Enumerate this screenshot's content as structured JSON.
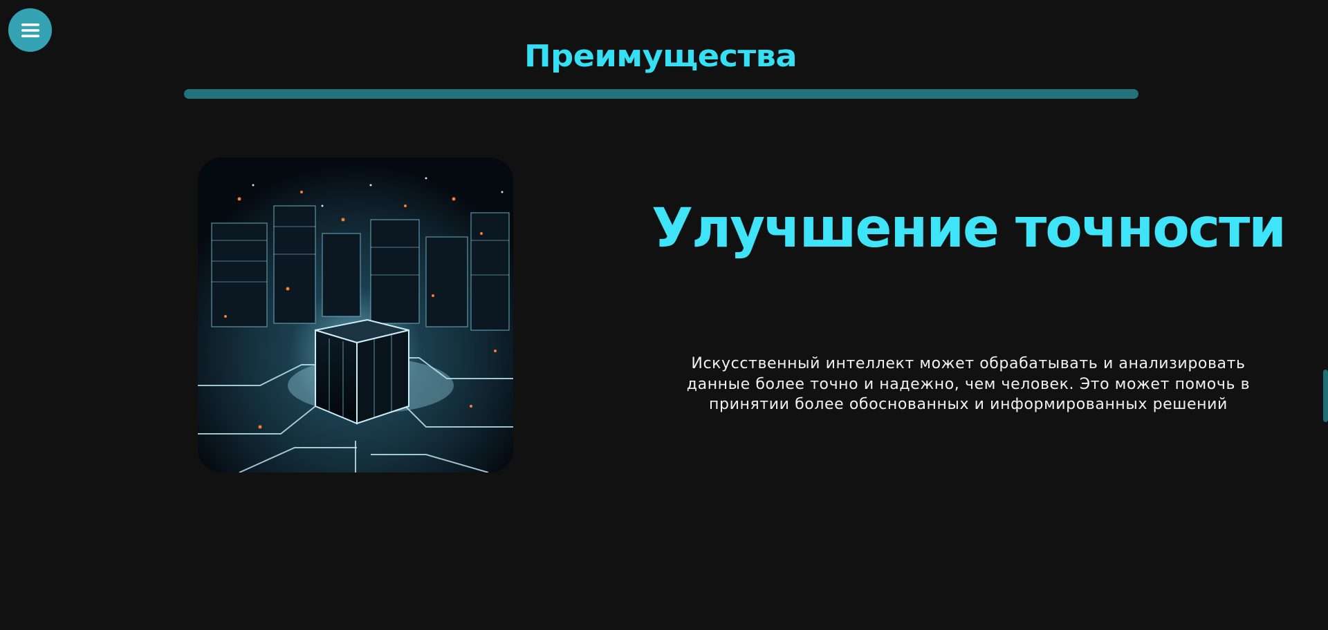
{
  "nav": {
    "menu_icon": "hamburger-menu-icon"
  },
  "section": {
    "title": "Преимущества"
  },
  "feature": {
    "heading": "Улучшение точности",
    "description": "Искусственный интеллект может обрабатывать и анализировать данные более точно и надежно, чем человек. Это может помочь в принятии более обоснованных и информированных решений"
  },
  "colors": {
    "background": "#111112",
    "accent": "#3fe4f8",
    "menu_button": "#35a3b3",
    "divider": "#23737c",
    "text": "#f2f2f2"
  }
}
